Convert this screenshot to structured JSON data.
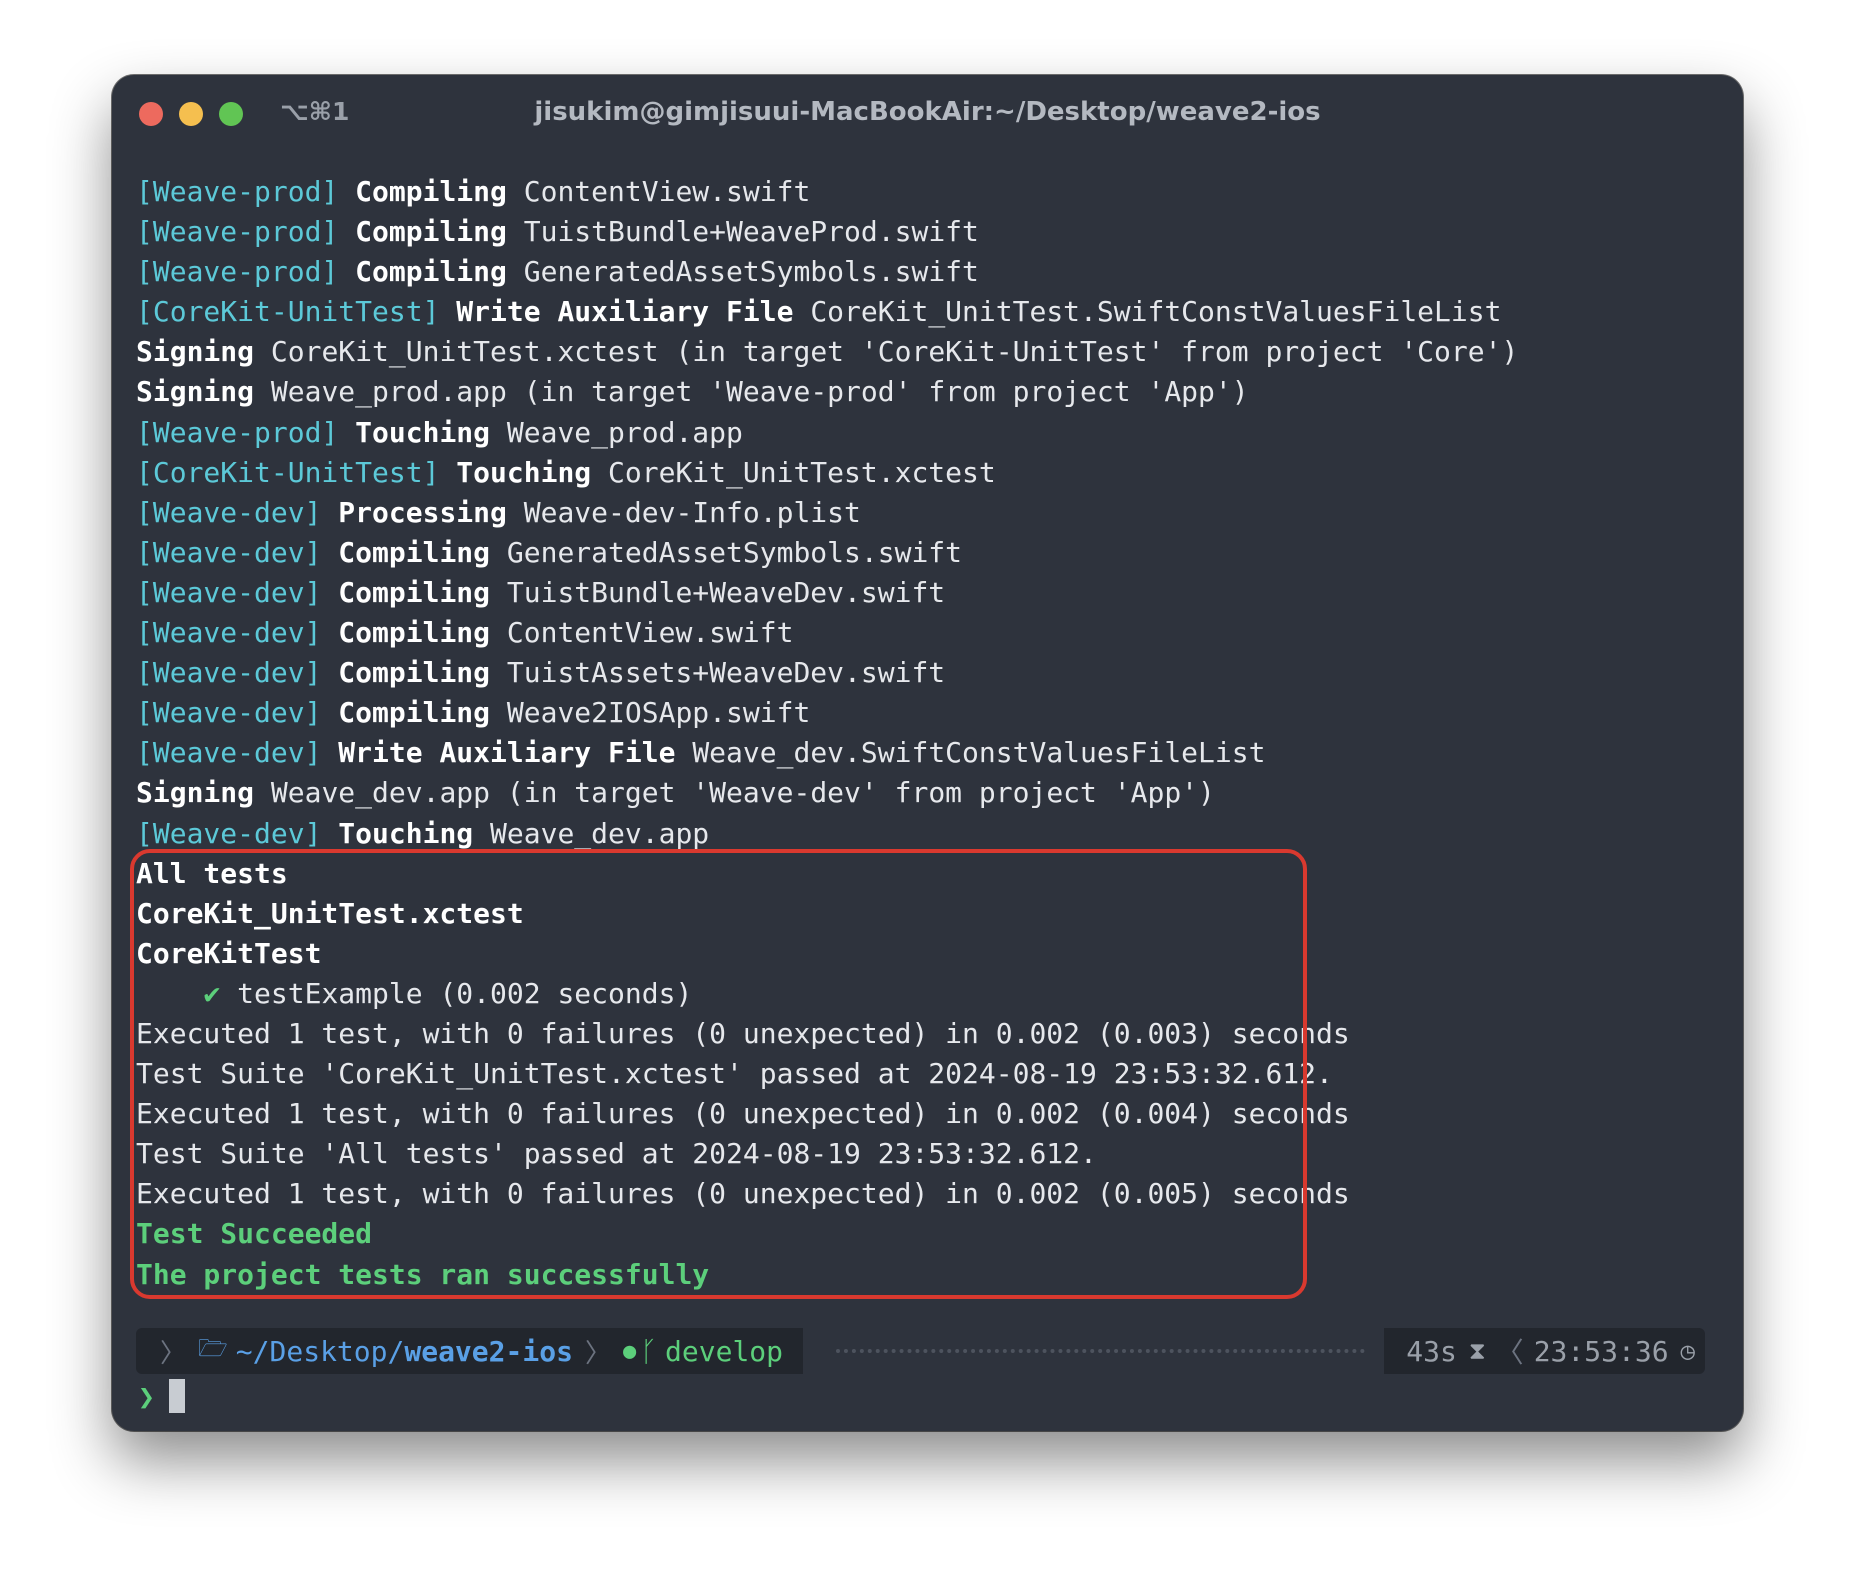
{
  "window": {
    "shortcut": "⌥⌘1",
    "title": "jisukim@gimjisuui-MacBookAir:~/Desktop/weave2-ios"
  },
  "log": [
    {
      "tag": "[Weave-prod]",
      "action": "Compiling",
      "rest": "ContentView.swift"
    },
    {
      "tag": "[Weave-prod]",
      "action": "Compiling",
      "rest": "TuistBundle+WeaveProd.swift"
    },
    {
      "tag": "[Weave-prod]",
      "action": "Compiling",
      "rest": "GeneratedAssetSymbols.swift"
    },
    {
      "tag": "[CoreKit-UnitTest]",
      "action": "Write Auxiliary File",
      "rest": "CoreKit_UnitTest.SwiftConstValuesFileList"
    },
    {
      "tag": "",
      "action": "Signing",
      "rest": "CoreKit_UnitTest.xctest (in target 'CoreKit-UnitTest' from project 'Core')"
    },
    {
      "tag": "",
      "action": "Signing",
      "rest": "Weave_prod.app (in target 'Weave-prod' from project 'App')"
    },
    {
      "tag": "[Weave-prod]",
      "action": "Touching",
      "rest": "Weave_prod.app"
    },
    {
      "tag": "[CoreKit-UnitTest]",
      "action": "Touching",
      "rest": "CoreKit_UnitTest.xctest"
    },
    {
      "tag": "[Weave-dev]",
      "action": "Processing",
      "rest": "Weave-dev-Info.plist"
    },
    {
      "tag": "[Weave-dev]",
      "action": "Compiling",
      "rest": "GeneratedAssetSymbols.swift"
    },
    {
      "tag": "[Weave-dev]",
      "action": "Compiling",
      "rest": "TuistBundle+WeaveDev.swift"
    },
    {
      "tag": "[Weave-dev]",
      "action": "Compiling",
      "rest": "ContentView.swift"
    },
    {
      "tag": "[Weave-dev]",
      "action": "Compiling",
      "rest": "TuistAssets+WeaveDev.swift"
    },
    {
      "tag": "[Weave-dev]",
      "action": "Compiling",
      "rest": "Weave2IOSApp.swift"
    },
    {
      "tag": "[Weave-dev]",
      "action": "Write Auxiliary File",
      "rest": "Weave_dev.SwiftConstValuesFileList"
    },
    {
      "tag": "",
      "action": "Signing",
      "rest": "Weave_dev.app (in target 'Weave-dev' from project 'App')"
    },
    {
      "tag": "[Weave-dev]",
      "action": "Touching",
      "rest": "Weave_dev.app"
    }
  ],
  "results": {
    "all_tests": "All tests",
    "bundle": "CoreKit_UnitTest.xctest",
    "suite": "CoreKitTest",
    "check": "✔",
    "test_case": "testExample (0.002 seconds)",
    "exec1": "Executed 1 test, with 0 failures (0 unexpected) in 0.002 (0.003) seconds",
    "suite_passed1": "Test Suite 'CoreKit_UnitTest.xctest' passed at 2024-08-19 23:53:32.612.",
    "exec2": "Executed 1 test, with 0 failures (0 unexpected) in 0.002 (0.004) seconds",
    "suite_passed2": "Test Suite 'All tests' passed at 2024-08-19 23:53:32.612.",
    "exec3": "Executed 1 test, with 0 failures (0 unexpected) in 0.002 (0.005) seconds",
    "succeeded": "Test Succeeded",
    "success_msg": "The project tests ran successfully"
  },
  "prompt": {
    "apple_icon": "apple-icon",
    "path_prefix": "~/Desktop/",
    "path_dir": "weave2-ios",
    "branch": "develop",
    "duration": "43s",
    "time": "23:53:36"
  },
  "colors": {
    "background": "#2e333d",
    "tag": "#5cc9d8",
    "success": "#5ccf7b",
    "highlight": "#d9392f",
    "path": "#5aa0e6"
  }
}
